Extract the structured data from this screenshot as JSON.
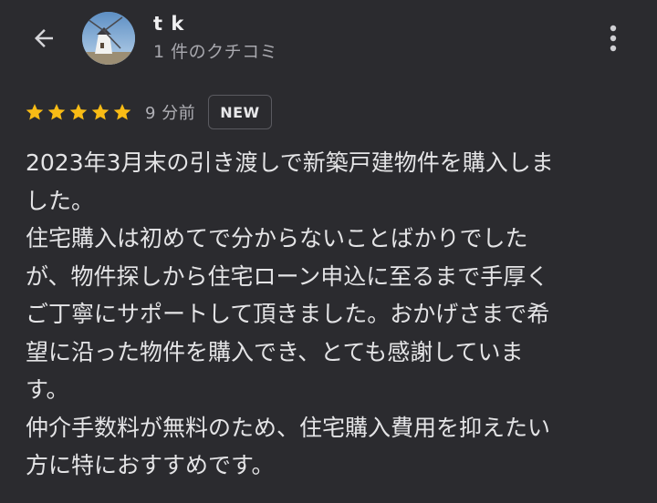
{
  "header": {
    "back_icon": "arrow-back-icon",
    "avatar_icon": "profile-photo-windmill",
    "user_name": "t k",
    "review_count": "1 件のクチコミ",
    "more_icon": "more-vert-icon"
  },
  "review": {
    "rating": 5,
    "rating_max": 5,
    "star_color": "#f9bc15",
    "time_ago": "9 分前",
    "badge": "NEW",
    "text": "2023年3月末の引き渡しで新築戸建物件を購入しま\nした。\n住宅購入は初めてで分からないことばかりでした\nが、物件探しから住宅ローン申込に至るまで手厚く\nご丁寧にサポートして頂きました。おかげさまで希\n望に沿った物件を購入でき、とても感謝していま\nす。\n仲介手数料が無料のため、住宅購入費用を抑えたい\n方に特におすすめです。"
  }
}
